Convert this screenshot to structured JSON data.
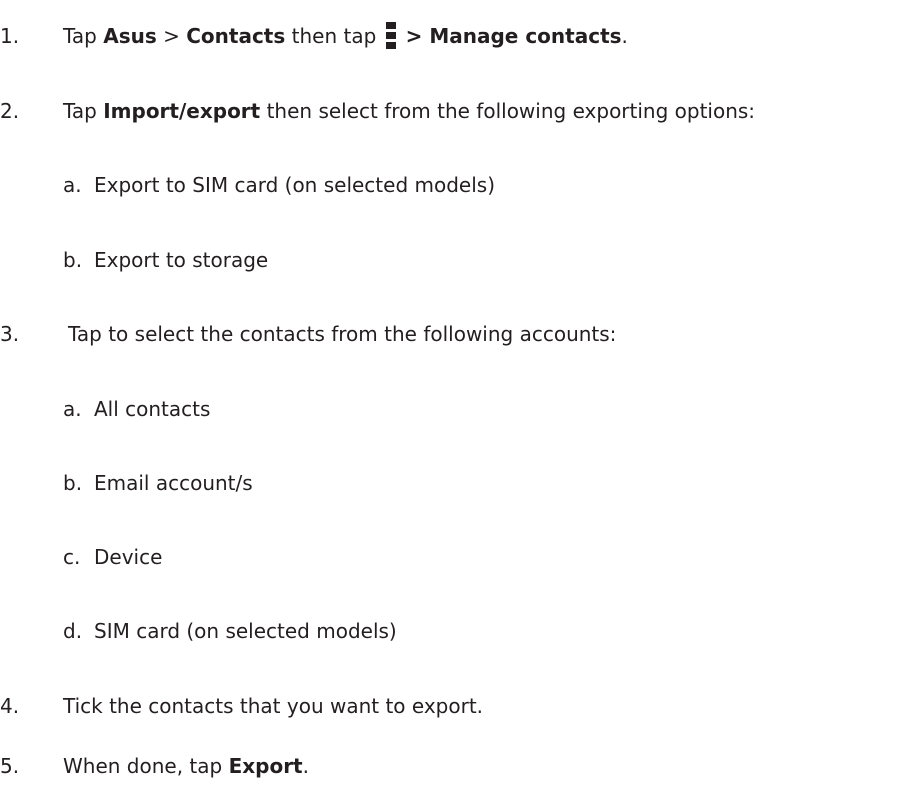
{
  "steps": [
    {
      "number": "1.",
      "t1": "Tap ",
      "b1": "Asus",
      "t2": " > ",
      "b2": "Contacts",
      "t3": " then tap ",
      "icon": "menu-icon",
      "b3": " > Manage contacts",
      "t4": "."
    },
    {
      "number": "2.",
      "t1": "Tap ",
      "b1": "Import/export",
      "t2": " then select from the following exporting options:",
      "options": [
        {
          "letter": "a.",
          "text": "Export to SIM card (on selected models)"
        },
        {
          "letter": "b.",
          "text": "Export to storage"
        }
      ]
    },
    {
      "number": "3.",
      "text": "Tap to select the contacts from the following accounts:",
      "options": [
        {
          "letter": "a.",
          "text": "All contacts"
        },
        {
          "letter": "b.",
          "text": "Email account/s"
        },
        {
          "letter": "c.",
          "text": "Device"
        },
        {
          "letter": "d.",
          "text": "SIM card (on selected models)"
        }
      ]
    },
    {
      "number": "4.",
      "text": "Tick the contacts that you want to export."
    },
    {
      "number": "5.",
      "t1": "When done, tap ",
      "b1": "Export",
      "t2": "."
    }
  ]
}
